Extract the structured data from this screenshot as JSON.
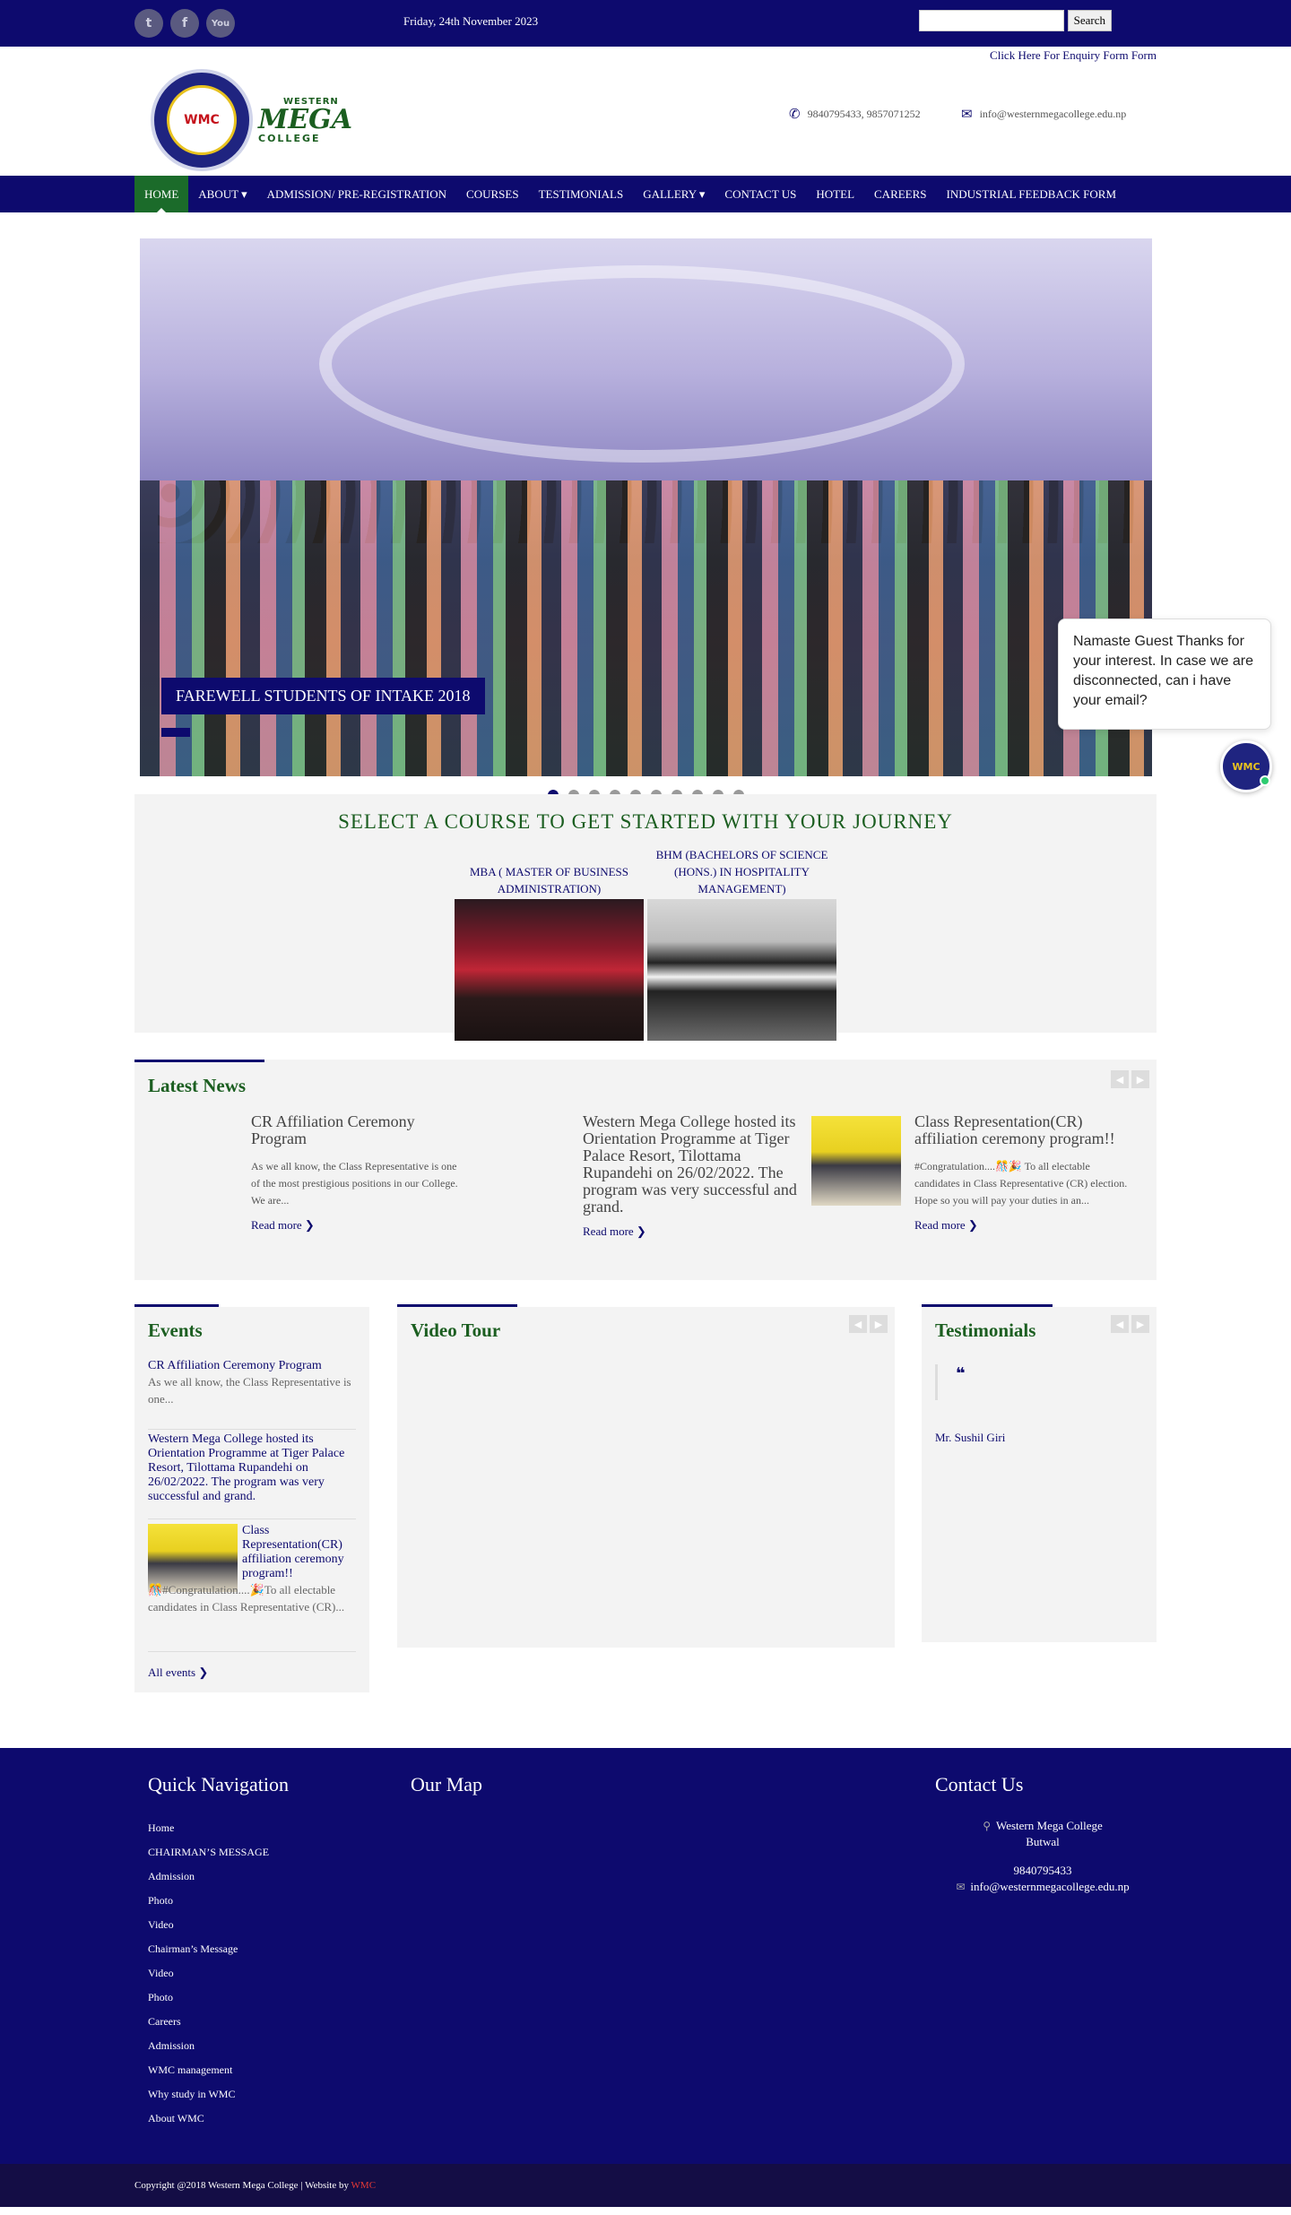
{
  "topbar": {
    "social": [
      "twitter-icon",
      "facebook-icon",
      "youtube-icon"
    ],
    "date": "Friday, 24th November 2023",
    "search_placeholder": "",
    "search_label": "Search"
  },
  "header": {
    "enquiry_link": "Click Here For Enquiry Form Form",
    "logo_seal_text": "WMC",
    "logo_top": "WESTERN",
    "logo_main": "MEGA",
    "logo_bottom": "COLLEGE",
    "phone": "9840795433, 9857071252",
    "email": "info@westernmegacollege.edu.np"
  },
  "nav": {
    "items": [
      {
        "label": "HOME",
        "active": true
      },
      {
        "label": "ABOUT ▾"
      },
      {
        "label": "ADMISSION/ PRE-REGISTRATION"
      },
      {
        "label": "COURSES"
      },
      {
        "label": "TESTIMONIALS"
      },
      {
        "label": "GALLERY ▾"
      },
      {
        "label": "CONTACT US"
      },
      {
        "label": "HOTEL"
      },
      {
        "label": "CAREERS"
      },
      {
        "label": "INDUSTRIAL FEEDBACK FORM"
      }
    ]
  },
  "slider": {
    "caption": "FAREWELL STUDENTS OF INTAKE 2018",
    "dot_count": 10,
    "active_dot": 0
  },
  "chat": {
    "message": "Namaste Guest Thanks for your interest. In case we are disconnected, can i have your email?",
    "online": true
  },
  "courses": {
    "heading": "SELECT A COURSE TO GET STARTED WITH YOUR JOURNEY",
    "items": [
      {
        "title": "MBA ( MASTER OF BUSINESS ADMINISTRATION)"
      },
      {
        "title": "BHM (BACHELORS OF SCIENCE (HONS.) IN HOSPITALITY MANAGEMENT)"
      }
    ]
  },
  "news": {
    "title": "Latest News",
    "items": [
      {
        "title": "CR Affiliation Ceremony Program",
        "desc": "As we all know, the Class Representative is one of the most prestigious positions in our College. We are...",
        "read_more": "Read more ❯"
      },
      {
        "title": "Western Mega College hosted its Orientation Programme at Tiger Palace Resort, Tilottama Rupandehi on 26/02/2022. The program was very successful and grand.",
        "desc": "",
        "read_more": "Read more ❯"
      },
      {
        "title": "Class Representation(CR) affiliation ceremony program!!",
        "desc": "#Congratulation....🎊🎉 To all electable candidates in Class Representative (CR) election. Hope so you will pay your duties in an...",
        "read_more": "Read more ❯"
      }
    ]
  },
  "events": {
    "title": "Events",
    "items": [
      {
        "title": "CR Affiliation Ceremony Program",
        "desc": "As we all know, the Class Representative is one..."
      },
      {
        "title": "Western Mega College hosted its Orientation Programme at Tiger Palace Resort, Tilottama Rupandehi on 26/02/2022. The program was very successful and grand.",
        "desc": ""
      },
      {
        "title": "Class Representation(CR) affiliation ceremony program!!",
        "desc": "🎊#Congratulation....🎉To all electable candidates in Class Representative (CR)..."
      }
    ],
    "all_link": "All events ❯"
  },
  "video": {
    "title": "Video Tour"
  },
  "testimonials": {
    "title": "Testimonials",
    "quote_mark": "❝",
    "name": "Mr. Sushil Giri"
  },
  "footer": {
    "nav_title": "Quick Navigation",
    "nav_items": [
      "Home",
      "CHAIRMAN’S MESSAGE",
      "Admission",
      "Photo",
      "Video",
      "Chairman’s Message",
      "Video",
      "Photo",
      "Careers",
      "Admission",
      "WMC management",
      "Why study in WMC",
      "About WMC"
    ],
    "map_title": "Our Map",
    "contact_title": "Contact Us",
    "address_line1": "Western Mega College",
    "address_line2": "Butwal",
    "phone": "9840795433",
    "email": "info@westernmegacollege.edu.np",
    "copyright": "Copyright @2018 Western Mega College | Website by",
    "credit": "WMC"
  },
  "colors": {
    "primary": "#0d0a6e",
    "accent_green": "#1b5e20",
    "panel": "#f3f3f3"
  }
}
